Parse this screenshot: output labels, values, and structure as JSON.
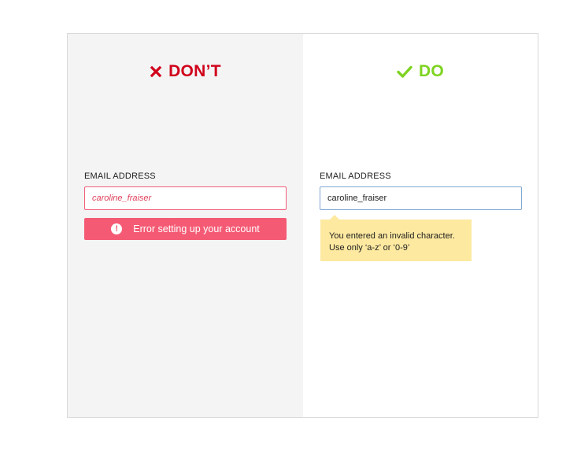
{
  "colors": {
    "dont_accent": "#d0021b",
    "do_accent": "#7ed321",
    "error_bar": "#f55a74",
    "error_input_border": "#f0607a",
    "tooltip_bg": "#fde9a0",
    "panel_dont_bg": "#f4f4f4"
  },
  "dont": {
    "heading": "DON’T",
    "heading_icon": "x-icon",
    "field_label": "EMAIL ADDRESS",
    "input_value": "caroline_fraiser",
    "error_icon": "alert-circle-icon",
    "error_message": "Error setting up your account"
  },
  "do": {
    "heading": "DO",
    "heading_icon": "checkmark-icon",
    "field_label": "EMAIL ADDRESS",
    "input_value": "caroline_fraiser",
    "tooltip_line1": "You entered an invalid character.",
    "tooltip_line2": "Use only ‘a-z’ or ‘0-9’"
  }
}
